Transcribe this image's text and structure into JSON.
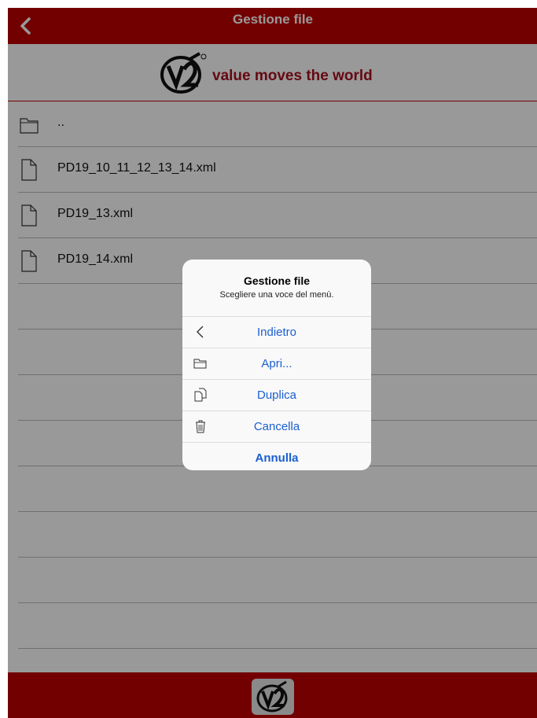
{
  "nav": {
    "title": "Gestione file"
  },
  "brand": {
    "tagline": "value moves the world"
  },
  "files": [
    {
      "name": "..",
      "icon": "folder-icon"
    },
    {
      "name": "PD19_10_11_12_13_14.xml",
      "icon": "file-icon"
    },
    {
      "name": "PD19_13.xml",
      "icon": "file-icon"
    },
    {
      "name": "PD19_14.xml",
      "icon": "file-icon"
    }
  ],
  "dialog": {
    "title": "Gestione file",
    "subtitle": "Scegliere una voce del menù.",
    "items": [
      {
        "label": "Indietro",
        "icon": "chevron-left-icon"
      },
      {
        "label": "Apri...",
        "icon": "folder-icon"
      },
      {
        "label": "Duplica",
        "icon": "duplicate-icon"
      },
      {
        "label": "Cancella",
        "icon": "trash-icon"
      }
    ],
    "cancel": "Annulla"
  },
  "colors": {
    "brand_red": "#c00000",
    "action_blue": "#1a5fd0",
    "tagline_red": "#a80f1f"
  }
}
